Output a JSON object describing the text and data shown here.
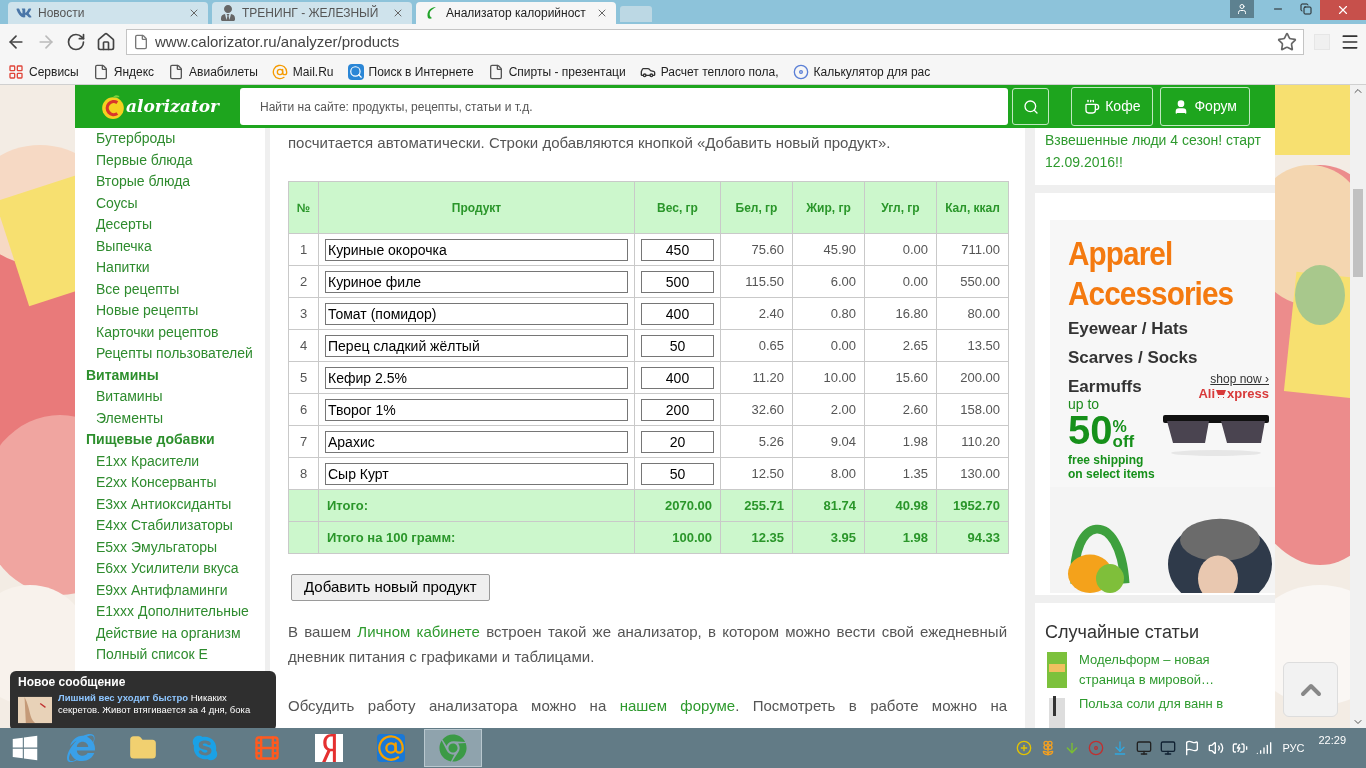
{
  "browser": {
    "tabs": [
      {
        "title": "Новости",
        "selected": false
      },
      {
        "title": "ТРЕНИНГ - ЖЕЛЕЗНЫЙ",
        "selected": false
      },
      {
        "title": "Анализатор калорийност",
        "selected": true
      }
    ],
    "url": "www.calorizator.ru/analyzer/products",
    "bookmarks": [
      "Сервисы",
      "Яндекс",
      "Авиабилеты",
      "Mail.Ru",
      "Поиск в Интернете",
      "Спирты - презентаци",
      "Расчет теплого пола,",
      "Калькулятор для рас"
    ]
  },
  "header": {
    "logo": "alorizator",
    "search_placeholder": "Найти на сайте: продукты, рецепты, статьи и т.д.",
    "buttons": [
      "Кофе",
      "Форум"
    ]
  },
  "sidebar": {
    "items": [
      {
        "text": "Бутерброды",
        "kind": "link"
      },
      {
        "text": "Первые блюда",
        "kind": "link"
      },
      {
        "text": "Вторые блюда",
        "kind": "link"
      },
      {
        "text": "Соусы",
        "kind": "link"
      },
      {
        "text": "Десерты",
        "kind": "link"
      },
      {
        "text": "Выпечка",
        "kind": "link"
      },
      {
        "text": "Напитки",
        "kind": "link"
      },
      {
        "text": "Все рецепты",
        "kind": "link"
      },
      {
        "text": "Новые рецепты",
        "kind": "link"
      },
      {
        "text": "Карточки рецептов",
        "kind": "link"
      },
      {
        "text": "Рецепты пользователей",
        "kind": "link"
      },
      {
        "text": "Витамины",
        "kind": "heading"
      },
      {
        "text": "Витамины",
        "kind": "link"
      },
      {
        "text": "Элементы",
        "kind": "link"
      },
      {
        "text": "Пищевые добавки",
        "kind": "heading"
      },
      {
        "text": "E1xx Красители",
        "kind": "link"
      },
      {
        "text": "E2xx Консерванты",
        "kind": "link"
      },
      {
        "text": "E3xx Антиоксиданты",
        "kind": "link"
      },
      {
        "text": "E4xx Стабилизаторы",
        "kind": "link"
      },
      {
        "text": "E5xx Эмульгаторы",
        "kind": "link"
      },
      {
        "text": "E6xx Усилители вкуса",
        "kind": "link"
      },
      {
        "text": "E9xx Антифламинги",
        "kind": "link"
      },
      {
        "text": "E1xxx Дополнительные",
        "kind": "link"
      },
      {
        "text": "Действие на организм",
        "kind": "link"
      },
      {
        "text": "Полный список Е",
        "kind": "link"
      }
    ]
  },
  "main": {
    "intro": "посчитается автоматически. Строки добавляются кнопкой «Добавить новый продукт».",
    "table": {
      "columns": [
        "№",
        "Продукт",
        "Вес, гр",
        "Бел, гр",
        "Жир, гр",
        "Угл, гр",
        "Кал, ккал"
      ],
      "rows": [
        {
          "num": "1",
          "product": "Куриные окорочка",
          "weight": "450",
          "protein": "75.60",
          "fat": "45.90",
          "carbs": "0.00",
          "kcal": "711.00"
        },
        {
          "num": "2",
          "product": "Куриное филе",
          "weight": "500",
          "protein": "115.50",
          "fat": "6.00",
          "carbs": "0.00",
          "kcal": "550.00"
        },
        {
          "num": "3",
          "product": "Томат (помидор)",
          "weight": "400",
          "protein": "2.40",
          "fat": "0.80",
          "carbs": "16.80",
          "kcal": "80.00"
        },
        {
          "num": "4",
          "product": "Перец сладкий жёлтый",
          "weight": "50",
          "protein": "0.65",
          "fat": "0.00",
          "carbs": "2.65",
          "kcal": "13.50"
        },
        {
          "num": "5",
          "product": "Кефир 2.5%",
          "weight": "400",
          "protein": "11.20",
          "fat": "10.00",
          "carbs": "15.60",
          "kcal": "200.00"
        },
        {
          "num": "6",
          "product": "Творог 1%",
          "weight": "200",
          "protein": "32.60",
          "fat": "2.00",
          "carbs": "2.60",
          "kcal": "158.00"
        },
        {
          "num": "7",
          "product": "Арахис",
          "weight": "20",
          "protein": "5.26",
          "fat": "9.04",
          "carbs": "1.98",
          "kcal": "110.20"
        },
        {
          "num": "8",
          "product": "Сыр Курт",
          "weight": "50",
          "protein": "12.50",
          "fat": "8.00",
          "carbs": "1.35",
          "kcal": "130.00"
        }
      ],
      "totals": [
        {
          "label": "Итого:",
          "weight": "2070.00",
          "protein": "255.71",
          "fat": "81.74",
          "carbs": "40.98",
          "kcal": "1952.70"
        },
        {
          "label": "Итого на 100 грамм:",
          "weight": "100.00",
          "protein": "12.35",
          "fat": "3.95",
          "carbs": "1.98",
          "kcal": "94.33"
        }
      ]
    },
    "add_button": "Добавить новый продукт",
    "paragraph_1": {
      "before": "В вашем",
      "link": "Личном кабинете",
      "after": "встроен такой же анализатор, в котором можно вести свой ежедневный дневник питания с графиками и таблицами."
    },
    "paragraph_2": {
      "before": "Обсудить работу анализатора можно на",
      "link": "нашем форуме",
      "after": ". Посмотреть в работе можно на"
    }
  },
  "right": {
    "news": "Взвешенные люди 4 сезон! старт 12.09.2016!!",
    "ad": {
      "title_1": "Apparel",
      "title_2": "Accessories",
      "lines": [
        "Eyewear / Hats",
        "Scarves / Socks",
        "Earmuffs"
      ],
      "shop": "shop now ›",
      "brand_1": "Ali",
      "brand_2": "xpress",
      "up_to": "up to",
      "percent": "50",
      "percent_sign": "%",
      "off": "off",
      "shipping_1": "free shipping",
      "shipping_2": "on select items"
    },
    "random_title": "Случайные статьи",
    "articles": [
      "Модельформ – новая страница в мировой…",
      "Польза соли для ванн в"
    ]
  },
  "popup": {
    "title": "Новое сообщение",
    "link": "Лишний вес уходит быстро",
    "text": "Никаких секретов. Живот втягивается за 4 дня, бока"
  },
  "taskbar": {
    "apps": [
      {
        "selected": false
      },
      {
        "selected": false
      },
      {
        "selected": false
      },
      {
        "selected": false
      },
      {
        "selected": false
      },
      {
        "selected": false
      },
      {
        "selected": true
      }
    ],
    "language": "РУС",
    "time": "22:29"
  }
}
